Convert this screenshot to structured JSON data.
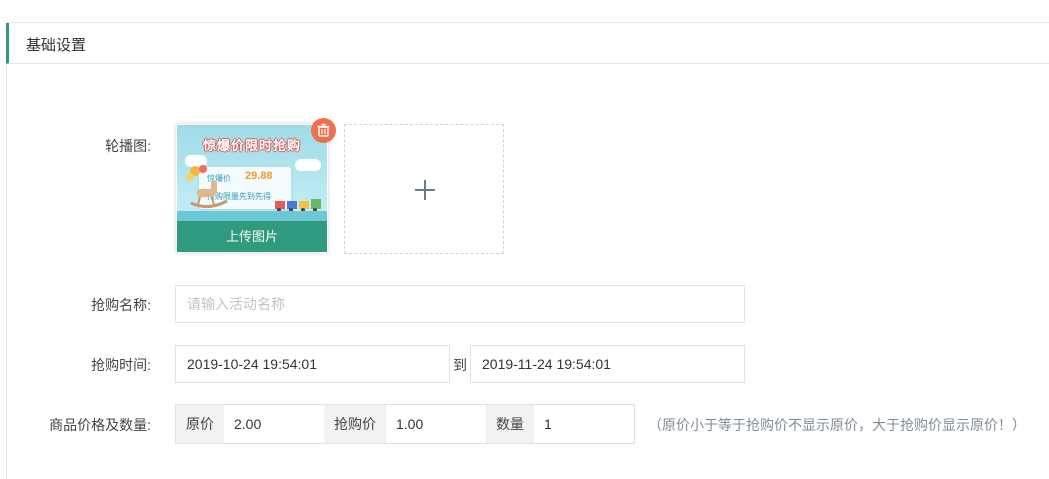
{
  "section": {
    "title": "基础设置"
  },
  "carousel": {
    "label": "轮播图:",
    "thumbnail": {
      "banner_title": "惊爆价限时抢购",
      "banner_price": "29.88",
      "upload_label": "上传图片"
    }
  },
  "activity_name": {
    "label": "抢购名称:",
    "value": "",
    "placeholder": "请输入活动名称"
  },
  "activity_time": {
    "label": "抢购时间:",
    "start": "2019-10-24 19:54:01",
    "separator": "到",
    "end": "2019-11-24 19:54:01"
  },
  "price_quantity": {
    "label": "商品价格及数量:",
    "original_price_label": "原价",
    "original_price": "2.00",
    "flash_price_label": "抢购价",
    "flash_price": "1.00",
    "quantity_label": "数量",
    "quantity": "1",
    "hint": "（原价小于等于抢购价不显示原价，大于抢购价显示原价！）"
  },
  "colors": {
    "accent": "#2f9a7e",
    "delete": "#f0704d"
  },
  "icons": [
    "trash-icon",
    "plus-icon"
  ]
}
